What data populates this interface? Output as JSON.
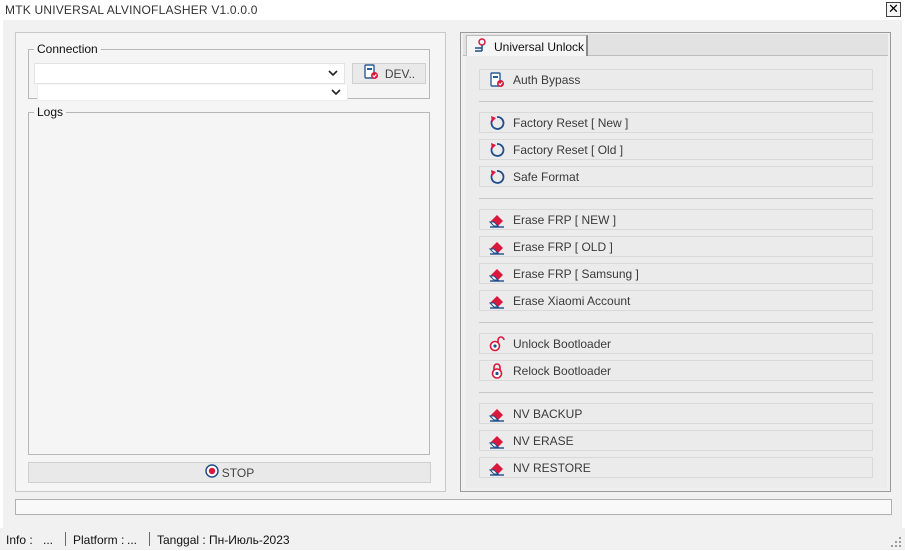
{
  "window": {
    "title": "MTK UNIVERSAL ALVINOFLASHER V1.0.0.0",
    "close_glyph": "✕"
  },
  "connection": {
    "label": "Connection",
    "port_value": "",
    "sub_value": "",
    "device_button": "DEV.."
  },
  "logs": {
    "label": "Logs",
    "content": ""
  },
  "stop_button": "STOP",
  "tabs": [
    {
      "label": "Universal Unlock",
      "active": true
    }
  ],
  "actions": [
    {
      "label": "Auth Bypass",
      "icon": "shield-check-icon"
    },
    {
      "label": "Factory Reset [ New ]",
      "icon": "reset-icon"
    },
    {
      "label": "Factory Reset [ Old ]",
      "icon": "reset-icon"
    },
    {
      "label": "Safe Format",
      "icon": "reset-icon"
    },
    {
      "label": "Erase FRP [ NEW ]",
      "icon": "eraser-icon"
    },
    {
      "label": "Erase FRP [ OLD ]",
      "icon": "eraser-icon"
    },
    {
      "label": "Erase FRP [ Samsung ]",
      "icon": "eraser-icon"
    },
    {
      "label": "Erase Xiaomi Account",
      "icon": "eraser-icon"
    },
    {
      "label": "Unlock Bootloader",
      "icon": "unlock-icon"
    },
    {
      "label": "Relock Bootloader",
      "icon": "lock-icon"
    },
    {
      "label": "NV BACKUP",
      "icon": "eraser-icon"
    },
    {
      "label": "NV ERASE",
      "icon": "eraser-icon"
    },
    {
      "label": "NV RESTORE",
      "icon": "eraser-icon"
    }
  ],
  "progress": {
    "value_fraction": 0
  },
  "status": {
    "info_label": "Info :",
    "info_value": "...",
    "platform_label": "Platform :",
    "platform_value": "...",
    "date_label": "Tanggal :",
    "date_value": "Пн-Июль-2023"
  },
  "colors": {
    "accent_red": "#d8183c",
    "accent_blue": "#1f4e8c",
    "progress_green": "#3c9f3c"
  }
}
